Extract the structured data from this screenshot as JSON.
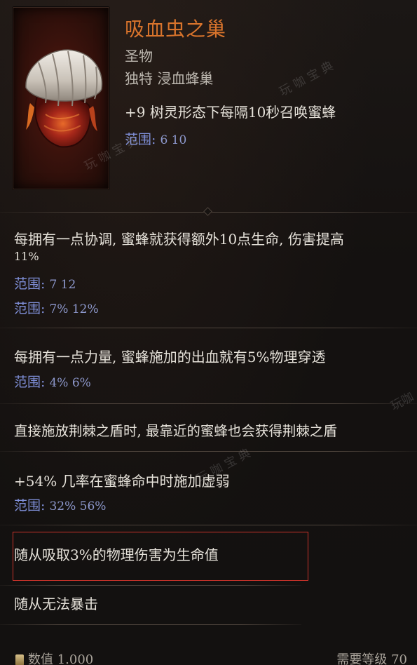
{
  "item": {
    "name": "吸血虫之巢",
    "category": "圣物",
    "rarity_line": "独特 浸血蜂巢",
    "header_affix": "+9 树灵形态下每隔10秒召唤蜜蜂",
    "header_range_label": "范围:",
    "header_range_values": "6   10"
  },
  "affixes": {
    "a1_line1": "每拥有一点协调, 蜜蜂就获得额外10点生命, 伤害提高",
    "a1_line2": "11%",
    "a1_range1_label": "范围:",
    "a1_range1_values": "7   12",
    "a1_range2_label": "范围:",
    "a1_range2_values": "7%   12%",
    "a2_line": "每拥有一点力量, 蜜蜂施加的出血就有5%物理穿透",
    "a2_range_label": "范围:",
    "a2_range_values": "4%   6%",
    "a3_line": "直接施放荆棘之盾时, 最靠近的蜜蜂也会获得荆棘之盾",
    "a4_line": "+54% 几率在蜜蜂命中时施加虚弱",
    "a4_range_label": "范围:",
    "a4_range_values": "32%   56%",
    "a5_line": "随从吸取3%的物理伤害为生命值",
    "a6_line": "随从无法暴击"
  },
  "footer": {
    "left": "数值 1.000",
    "right": "需要等级 70"
  },
  "watermarks": {
    "w1": "玩 咖 宝 典",
    "w2": "玩 咖 宝 典",
    "w3": "玩 咖 宝 典",
    "w4": "玩咖"
  },
  "colors": {
    "title": "#d9742c",
    "range_label": "#7f8fd8",
    "highlight_border": "#c8322a"
  },
  "icons": {
    "item_icon": "blood-hive-relic-icon",
    "footer_icon": "coin-icon"
  }
}
